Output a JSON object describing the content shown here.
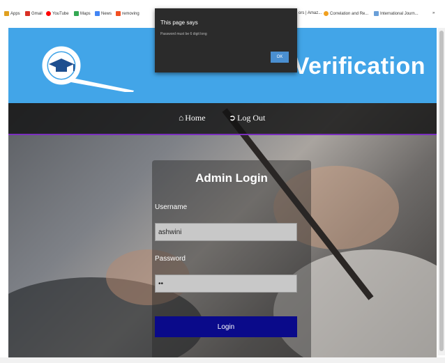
{
  "bookmarks": [
    {
      "label": "Apps",
      "icon": "apps-grid-icon",
      "color": "#e0a020"
    },
    {
      "label": "Gmail",
      "icon": "gmail-icon",
      "color": "#d93025"
    },
    {
      "label": "YouTube",
      "icon": "youtube-icon",
      "color": "#ff0000"
    },
    {
      "label": "Maps",
      "icon": "maps-icon",
      "color": "#34a853"
    },
    {
      "label": "News",
      "icon": "news-icon",
      "color": "#4285f4"
    },
    {
      "label": "removing",
      "icon": "windows-icon",
      "color": "#f25022"
    },
    {
      "label": "ors | Amaz...",
      "icon": "",
      "color": ""
    },
    {
      "label": "Correlation and Re...",
      "icon": "page-icon",
      "color": "#f0a020"
    },
    {
      "label": "International Journ...",
      "icon": "page-icon",
      "color": "#6a9fd8"
    },
    {
      "label": "»",
      "icon": "",
      "color": ""
    }
  ],
  "header": {
    "brand_text": "Verification",
    "color": "#42a5e8"
  },
  "nav": {
    "home": "Home",
    "logout": "Log Out",
    "accent": "#7b2fbf"
  },
  "login": {
    "title": "Admin Login",
    "username_label": "Username",
    "username_value": "ashwini",
    "password_label": "Password",
    "password_value": "••",
    "button": "Login",
    "button_color": "#0a0a8a"
  },
  "alert": {
    "title": "This page says",
    "message": "Password must be 6 digit long",
    "ok": "OK"
  }
}
